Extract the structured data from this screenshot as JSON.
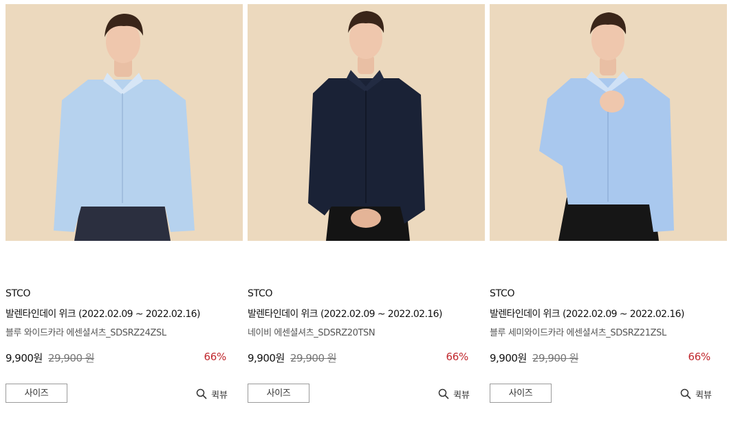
{
  "products": [
    {
      "brand": "STCO",
      "event": "발렌타인데이 위크 (2022.02.09 ~ 2022.02.16)",
      "name": "블루 와이드카라 에센셜셔츠_SDSRZ24ZSL",
      "price": "9,900원",
      "original_price": "29,900 원",
      "discount": "66%",
      "size_label": "사이즈",
      "quickview_label": "퀵뷰",
      "shirt_color": "#b6d2ee",
      "pants_color": "#2b2f3f"
    },
    {
      "brand": "STCO",
      "event": "발렌타인데이 위크 (2022.02.09 ~ 2022.02.16)",
      "name": "네이비 에센셜셔츠_SDSRZ20TSN",
      "price": "9,900원",
      "original_price": "29,900 원",
      "discount": "66%",
      "size_label": "사이즈",
      "quickview_label": "퀵뷰",
      "shirt_color": "#1a2236",
      "pants_color": "#141414"
    },
    {
      "brand": "STCO",
      "event": "발렌타인데이 위크 (2022.02.09 ~ 2022.02.16)",
      "name": "블루 세미와이드카라 에센셜셔츠_SDSRZ21ZSL",
      "price": "9,900원",
      "original_price": "29,900 원",
      "discount": "66%",
      "size_label": "사이즈",
      "quickview_label": "퀵뷰",
      "shirt_color": "#a9c8ee",
      "pants_color": "#161616"
    }
  ],
  "colors": {
    "photo_background": "#ecd9be",
    "discount_red": "#c0272d"
  },
  "icons": {
    "quickview": "search-icon"
  }
}
